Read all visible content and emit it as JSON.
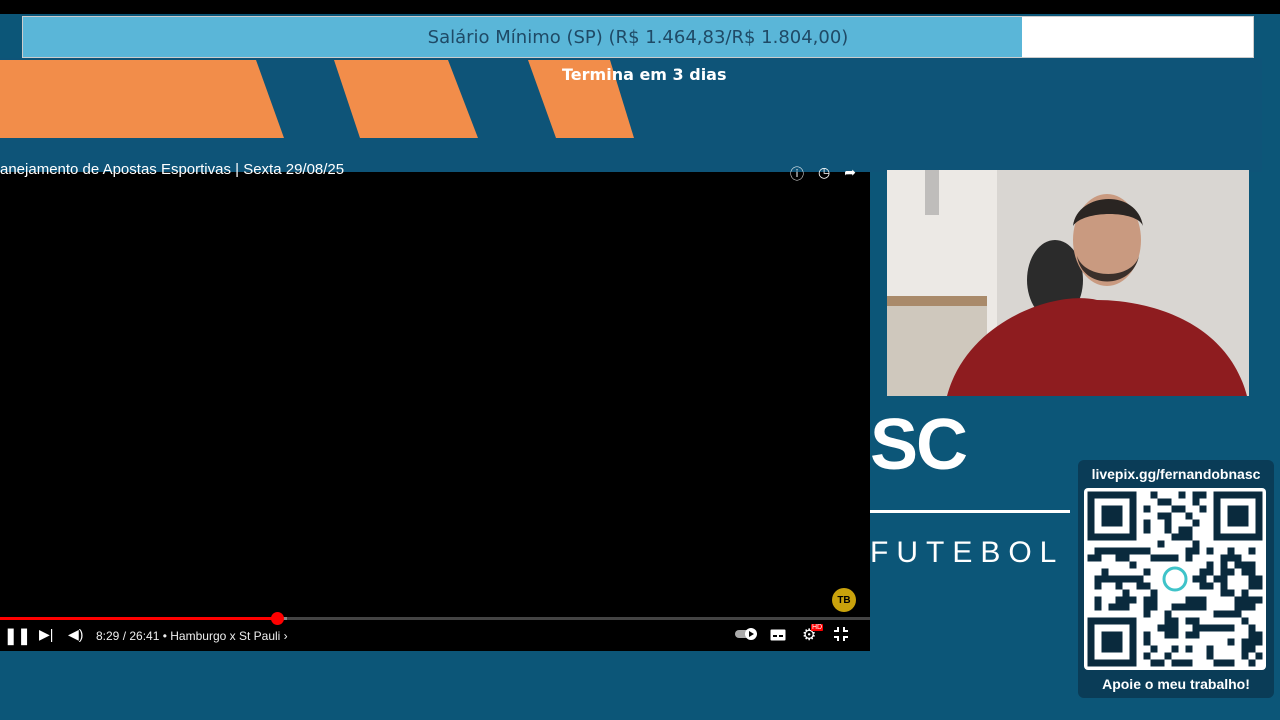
{
  "goal": {
    "label": "Salário Mínimo (SP) (R$ 1.464,83/R$ 1.804,00)",
    "progress_fraction": 0.812
  },
  "banner": {
    "ends_text": "Termina em 3 dias"
  },
  "video": {
    "title": "anejamento de Apostas Esportivas | Sexta 29/08/25",
    "time": "8:29 / 26:41",
    "chapter": "• Hamburgo x St Pauli",
    "progress_fraction": 0.318,
    "loaded_fraction": 0.33,
    "channel_logo": "TB",
    "hd_badge": "HD"
  },
  "brand": {
    "partial_logo": "SC",
    "tagline": "FUTEBOL"
  },
  "livepix": {
    "url": "livepix.gg/fernandobnasc",
    "cta": "Apoie o meu trabalho!"
  },
  "icons": {
    "pause": "pause-icon",
    "next": "next-icon",
    "volume": "volume-icon",
    "autoplay": "autoplay-toggle-icon",
    "subtitles": "subtitles-icon",
    "settings": "gear-icon",
    "fullscreen": "exit-fullscreen-icon"
  },
  "colors": {
    "background": "#0c5678",
    "stripe": "#f28d4a",
    "goal_fill": "#5ab6d8",
    "progress": "#ff0000"
  }
}
